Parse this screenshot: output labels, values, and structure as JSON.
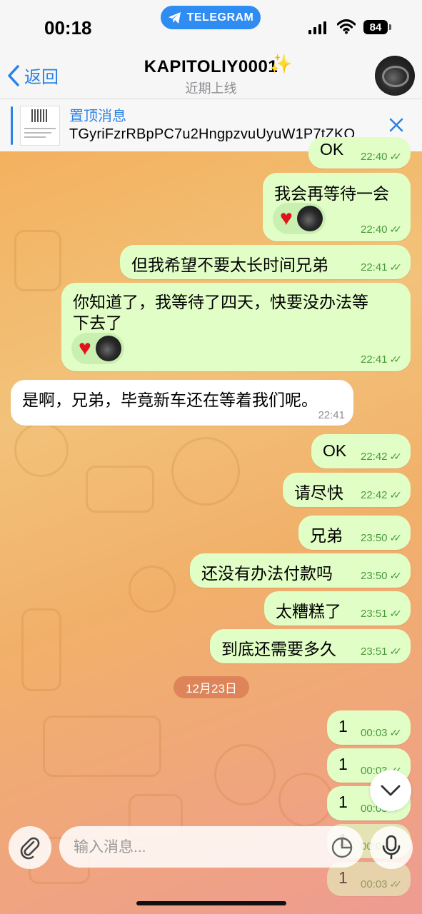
{
  "status_bar": {
    "time": "00:18",
    "app_pill": "TELEGRAM",
    "battery": "84"
  },
  "header": {
    "back_label": "返回",
    "contact_name": "KAPITOLIY0001",
    "contact_status": "近期上线"
  },
  "pinned": {
    "title": "置顶消息",
    "text": "TGyriFzrRBpPC7u2HngpzvuUyuW1P7tZKQ"
  },
  "messages": [
    {
      "dir": "out",
      "text": "OK",
      "time": "22:40"
    },
    {
      "dir": "out",
      "text": "我会再等待一会",
      "time": "22:40",
      "reaction": "heart"
    },
    {
      "dir": "out",
      "text": "但我希望不要太长时间兄弟",
      "time": "22:41"
    },
    {
      "dir": "out",
      "text_line1": "你知道了，我等待了四天，快要没办法等",
      "text_line2": "下去了",
      "time": "22:41",
      "reaction": "heart"
    },
    {
      "dir": "in",
      "text": "是啊，兄弟，毕竟新车还在等着我们呢。",
      "time": "22:41"
    },
    {
      "dir": "out",
      "text": "OK",
      "time": "22:42"
    },
    {
      "dir": "out",
      "text": "请尽快",
      "time": "22:42"
    },
    {
      "dir": "out",
      "text": "兄弟",
      "time": "23:50"
    },
    {
      "dir": "out",
      "text": "还没有办法付款吗",
      "time": "23:50"
    },
    {
      "dir": "out",
      "text": "太糟糕了",
      "time": "23:51"
    },
    {
      "dir": "out",
      "text": "到底还需要多久",
      "time": "23:51"
    },
    {
      "dir": "out",
      "text": "1",
      "time": "00:03"
    },
    {
      "dir": "out",
      "text": "1",
      "time": "00:03"
    },
    {
      "dir": "out",
      "text": "1",
      "time": "00:03"
    },
    {
      "dir": "out",
      "text": "1",
      "time": "00:03"
    },
    {
      "dir": "out",
      "text": "1",
      "time": "00:03"
    }
  ],
  "date_separator": "12月23日",
  "composer": {
    "placeholder": "输入消息..."
  },
  "colors": {
    "accent": "#2b82e4",
    "outgoing_bubble": "#e1fec6",
    "incoming_bubble": "#ffffff",
    "heart": "#e0121a"
  },
  "icons": [
    "telegram-icon",
    "back-chevron-icon",
    "close-icon",
    "heart-icon",
    "double-check-icon",
    "chevron-down-icon",
    "paperclip-icon",
    "sticker-icon",
    "microphone-icon"
  ]
}
